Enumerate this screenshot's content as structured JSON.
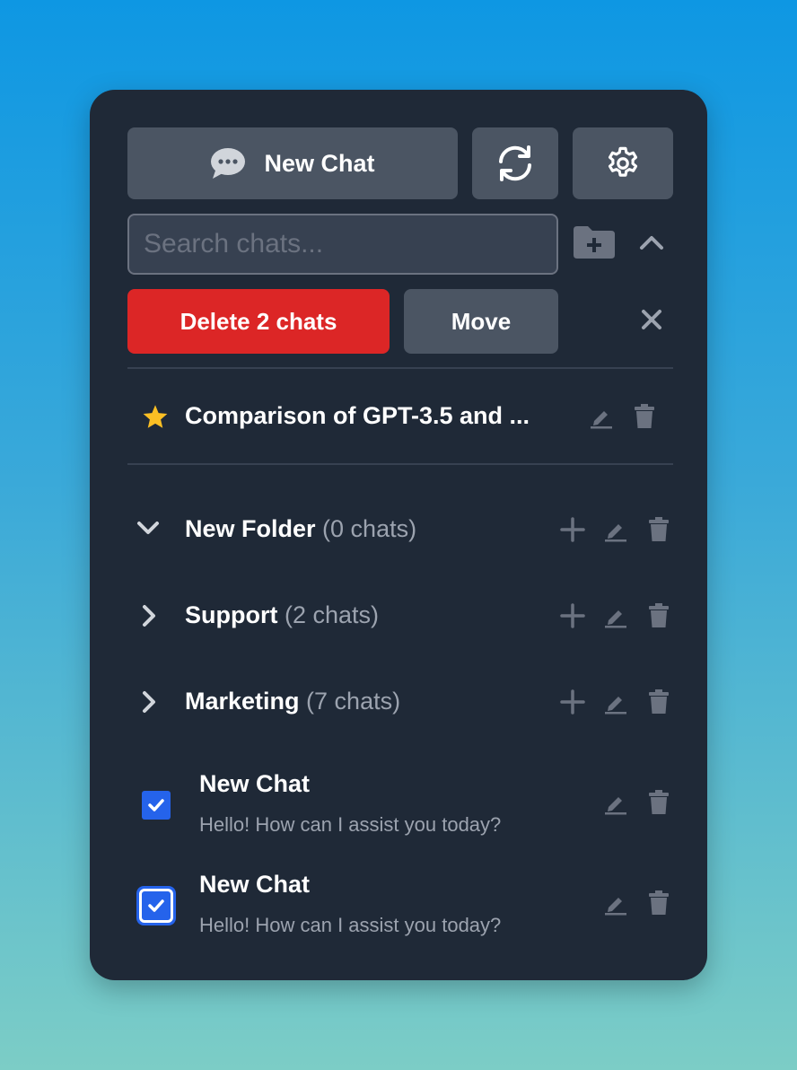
{
  "toolbar": {
    "new_chat_label": "New Chat",
    "refresh_icon": "refresh-icon",
    "settings_icon": "gear-icon"
  },
  "search": {
    "placeholder": "Search chats...",
    "value": ""
  },
  "selection_bar": {
    "delete_label": "Delete 2 chats",
    "move_label": "Move"
  },
  "favorites": [
    {
      "title": "Comparison of GPT-3.5 and ..."
    }
  ],
  "folders": [
    {
      "name": "New Folder",
      "count": "(0 chats)",
      "expanded": true
    },
    {
      "name": "Support",
      "count": "(2 chats)",
      "expanded": false
    },
    {
      "name": "Marketing",
      "count": "(7 chats)",
      "expanded": false
    }
  ],
  "chats": [
    {
      "title": "New Chat",
      "preview": "Hello! How can I assist you today?",
      "checked": true
    },
    {
      "title": "New Chat",
      "preview": "Hello! How can I assist you today?",
      "checked": true
    }
  ],
  "colors": {
    "panel": "#1f2937",
    "button": "#4b5563",
    "danger": "#dc2626",
    "accent": "#2563eb",
    "star": "#fbbf24",
    "muted": "#9ca3af"
  }
}
